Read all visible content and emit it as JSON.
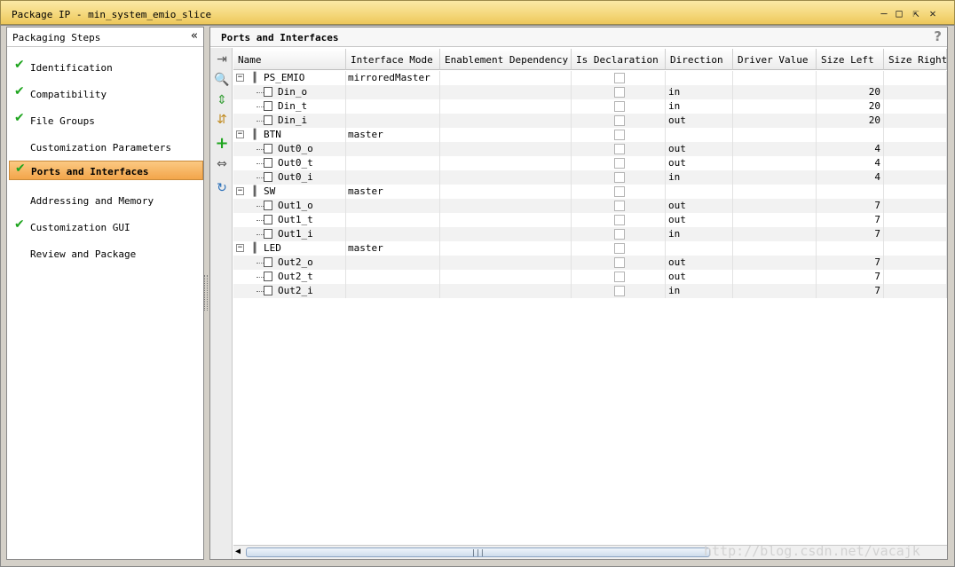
{
  "window": {
    "title": "Package IP - min_system_emio_slice"
  },
  "sidebar": {
    "header": "Packaging Steps",
    "items": [
      {
        "label": "Identification",
        "done": true
      },
      {
        "label": "Compatibility",
        "done": true
      },
      {
        "label": "File Groups",
        "done": true
      },
      {
        "label": "Customization Parameters",
        "done": false
      },
      {
        "label": "Ports and Interfaces",
        "done": true,
        "active": true
      },
      {
        "label": "Addressing and Memory",
        "done": false
      },
      {
        "label": "Customization GUI",
        "done": true
      },
      {
        "label": "Review and Package",
        "done": false
      }
    ]
  },
  "main": {
    "title": "Ports and Interfaces",
    "help": "?",
    "columns": [
      "Name",
      "Interface Mode",
      "Enablement Dependency",
      "Is Declaration",
      "Direction",
      "Driver Value",
      "Size Left",
      "Size Right"
    ],
    "rows": [
      {
        "type": "if",
        "name": "PS_EMIO",
        "mode": "mirroredMaster",
        "dir": "",
        "left": ""
      },
      {
        "type": "port",
        "name": "Din_o",
        "mode": "",
        "dir": "in",
        "left": "20"
      },
      {
        "type": "port",
        "name": "Din_t",
        "mode": "",
        "dir": "in",
        "left": "20"
      },
      {
        "type": "port",
        "name": "Din_i",
        "mode": "",
        "dir": "out",
        "left": "20"
      },
      {
        "type": "if",
        "name": "BTN",
        "mode": "master",
        "dir": "",
        "left": ""
      },
      {
        "type": "port",
        "name": "Out0_o",
        "mode": "",
        "dir": "out",
        "left": "4"
      },
      {
        "type": "port",
        "name": "Out0_t",
        "mode": "",
        "dir": "out",
        "left": "4"
      },
      {
        "type": "port",
        "name": "Out0_i",
        "mode": "",
        "dir": "in",
        "left": "4"
      },
      {
        "type": "if",
        "name": "SW",
        "mode": "master",
        "dir": "",
        "left": ""
      },
      {
        "type": "port",
        "name": "Out1_o",
        "mode": "",
        "dir": "out",
        "left": "7"
      },
      {
        "type": "port",
        "name": "Out1_t",
        "mode": "",
        "dir": "out",
        "left": "7"
      },
      {
        "type": "port",
        "name": "Out1_i",
        "mode": "",
        "dir": "in",
        "left": "7"
      },
      {
        "type": "if",
        "name": "LED",
        "mode": "master",
        "dir": "",
        "left": ""
      },
      {
        "type": "port",
        "name": "Out2_o",
        "mode": "",
        "dir": "out",
        "left": "7"
      },
      {
        "type": "port",
        "name": "Out2_t",
        "mode": "",
        "dir": "out",
        "left": "7"
      },
      {
        "type": "port",
        "name": "Out2_i",
        "mode": "",
        "dir": "in",
        "left": "7"
      }
    ]
  },
  "toolbar": {
    "icons": [
      "collapse-all-icon",
      "search-icon",
      "expand-icon",
      "collapse-icon",
      "add-icon",
      "merge-icon",
      "refresh-icon"
    ]
  },
  "watermark": "http://blog.csdn.net/vacajk",
  "colors": {
    "title_bar": "#f4d77a",
    "active_step": "#f3a54a",
    "check": "#1fa51f"
  }
}
